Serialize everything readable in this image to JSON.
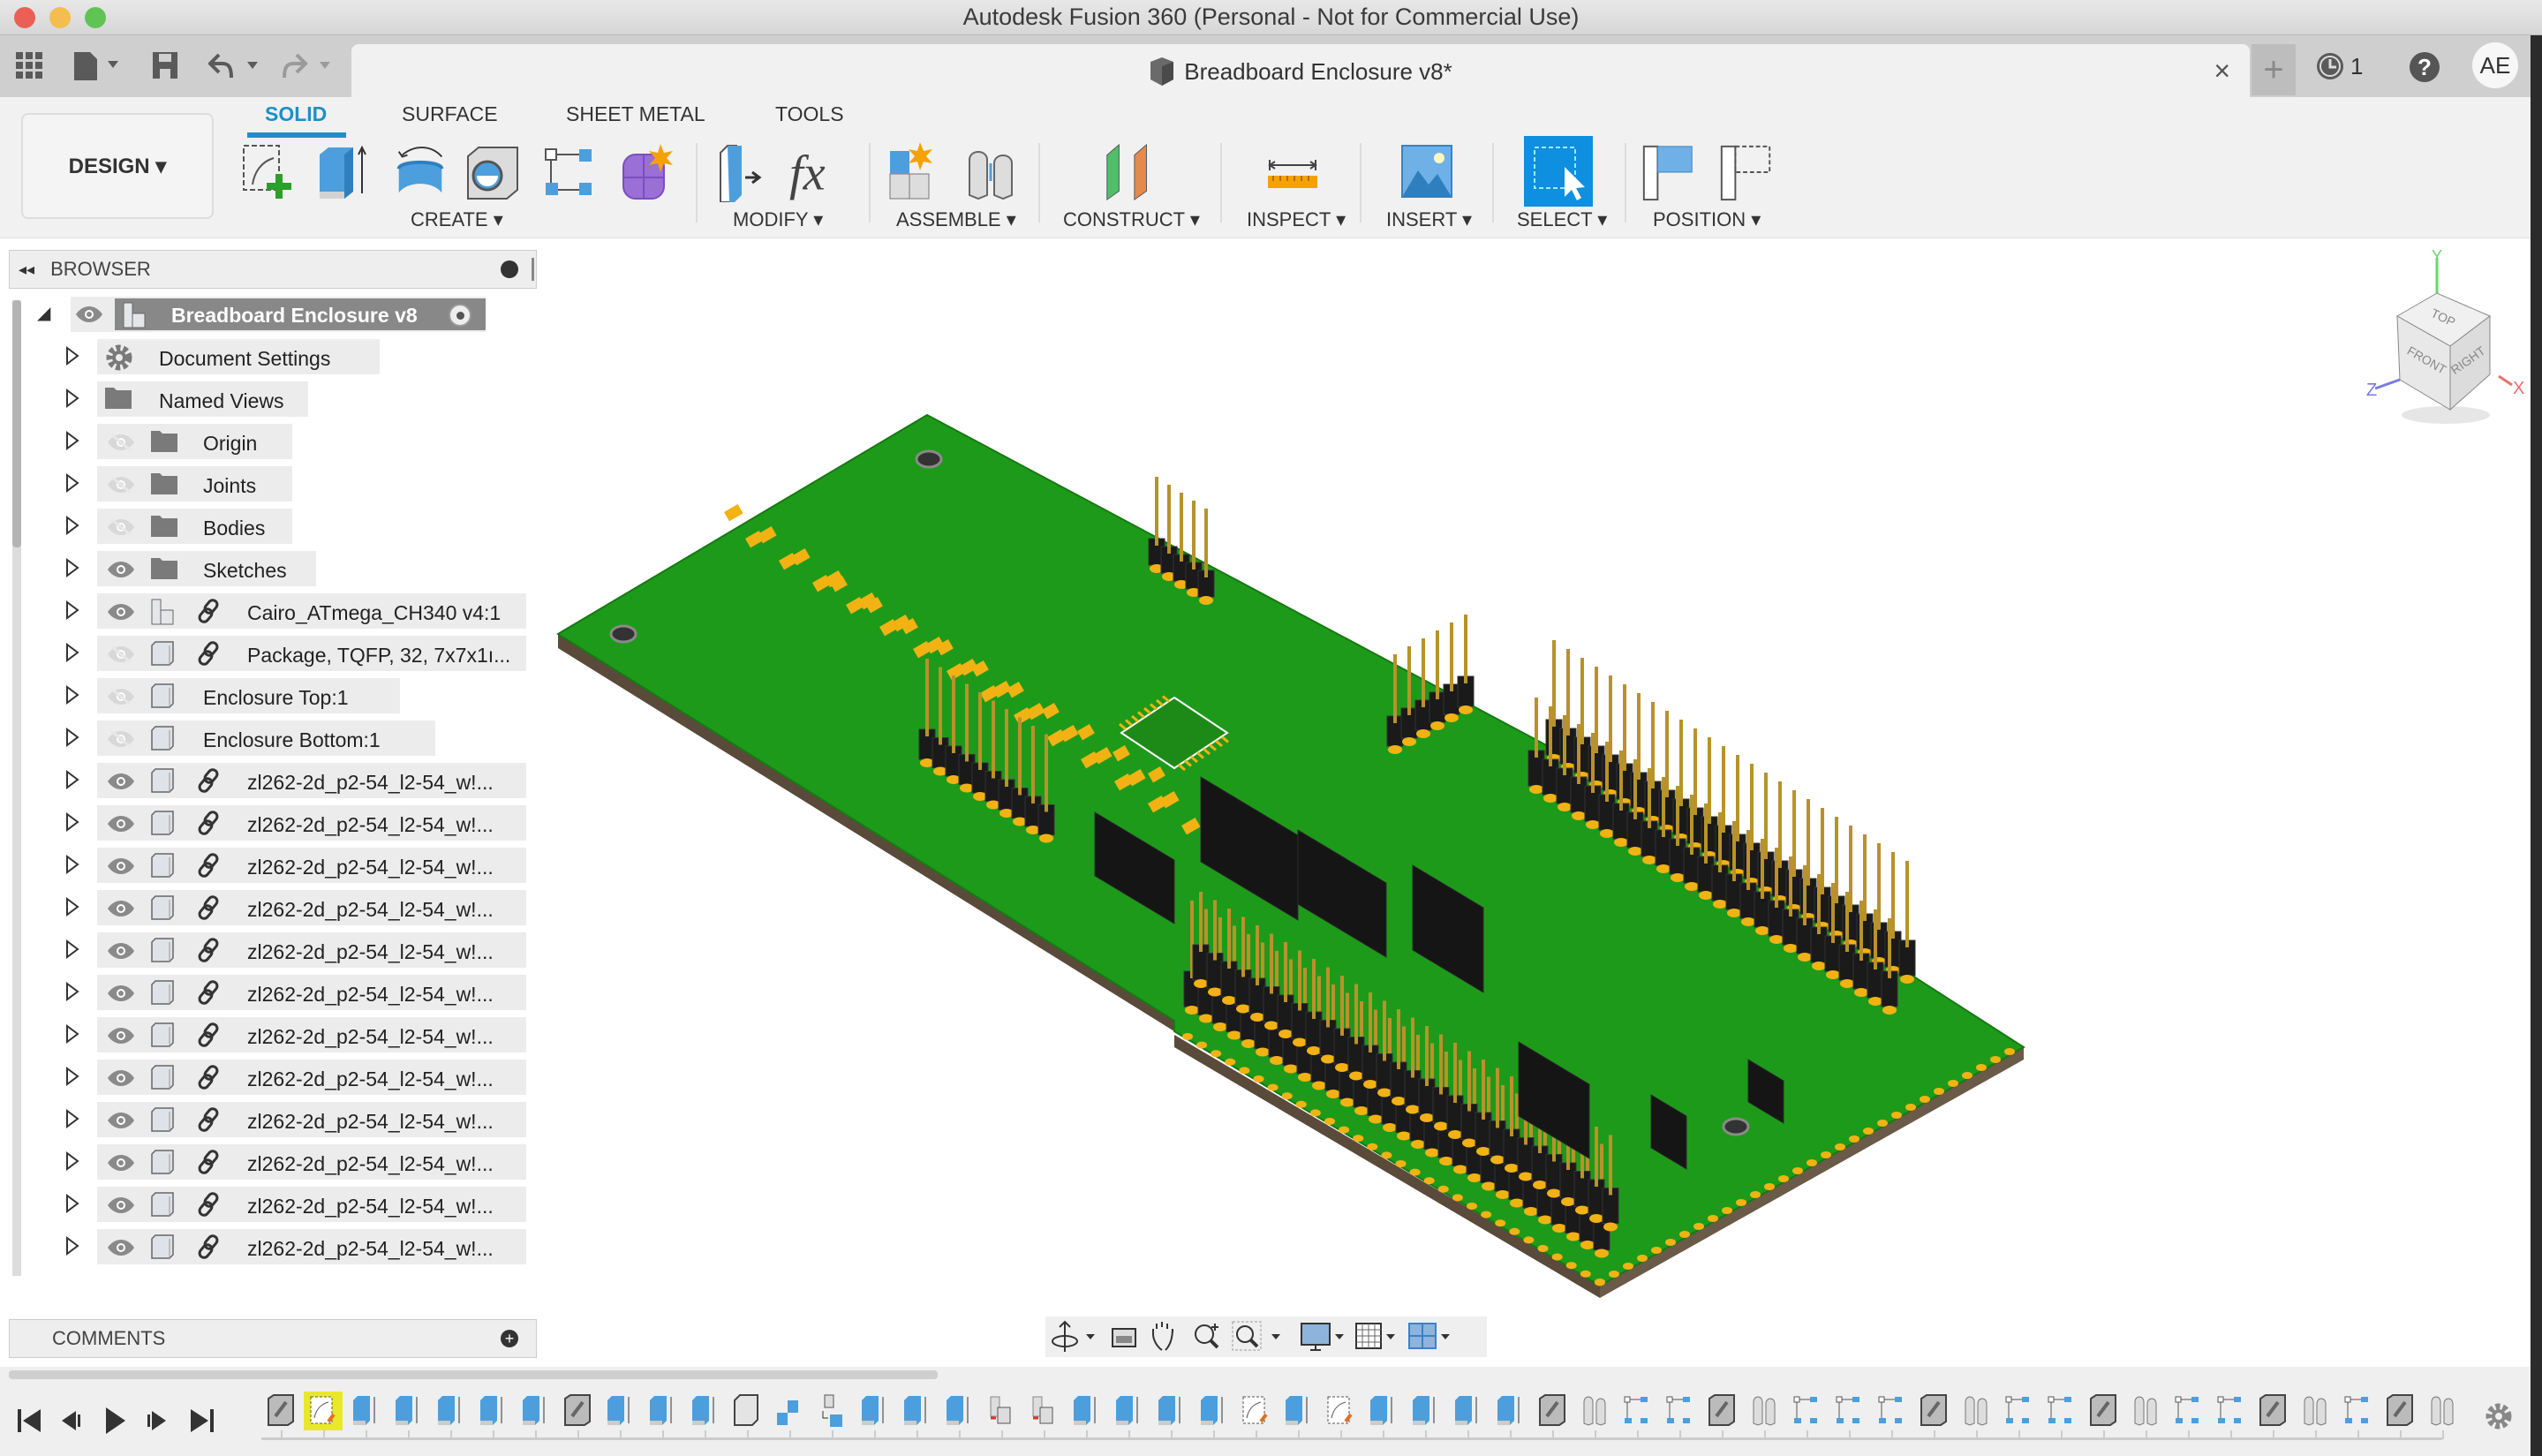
{
  "window": {
    "title": "Autodesk Fusion 360 (Personal - Not for Commercial Use)"
  },
  "quick_access": {
    "icons": [
      "grid-menu-icon",
      "file-icon",
      "save-icon",
      "undo-icon",
      "redo-icon"
    ]
  },
  "document_tab": {
    "title": "Breadboard Enclosure v8*",
    "close_label": "×",
    "new_tab_label": "+"
  },
  "header_right": {
    "jobs_count": "1",
    "help_label": "?",
    "user_initials": "AE"
  },
  "ribbon": {
    "workspace_label": "DESIGN ▾",
    "tabs": [
      {
        "label": "SOLID",
        "active": true
      },
      {
        "label": "SURFACE",
        "active": false
      },
      {
        "label": "SHEET METAL",
        "active": false
      },
      {
        "label": "TOOLS",
        "active": false
      }
    ],
    "groups": [
      {
        "label": "CREATE ▾",
        "tools": [
          "create-sketch",
          "extrude",
          "revolve",
          "hole",
          "rectangular-pattern",
          "create-form"
        ]
      },
      {
        "label": "MODIFY ▾",
        "tools": [
          "press-pull",
          "change-parameters"
        ]
      },
      {
        "label": "ASSEMBLE ▾",
        "tools": [
          "new-component",
          "joint"
        ]
      },
      {
        "label": "CONSTRUCT ▾",
        "tools": [
          "offset-plane"
        ]
      },
      {
        "label": "INSPECT ▾",
        "tools": [
          "measure"
        ]
      },
      {
        "label": "INSERT ▾",
        "tools": [
          "insert-canvas"
        ]
      },
      {
        "label": "SELECT ▾",
        "tools": [
          "select"
        ]
      },
      {
        "label": "POSITION ▾",
        "tools": [
          "capture-position",
          "revert-position"
        ]
      }
    ]
  },
  "browser": {
    "title": "BROWSER",
    "root": {
      "label": "Breadboard Enclosure v8",
      "visible": true
    },
    "items": [
      {
        "label": "Document Settings",
        "icon": "gear",
        "eye": null,
        "link": false
      },
      {
        "label": "Named Views",
        "icon": "folder",
        "eye": null,
        "link": false
      },
      {
        "label": "Origin",
        "icon": "folder",
        "eye": "hidden",
        "link": false
      },
      {
        "label": "Joints",
        "icon": "folder",
        "eye": "hidden",
        "link": false
      },
      {
        "label": "Bodies",
        "icon": "folder",
        "eye": "hidden",
        "link": false
      },
      {
        "label": "Sketches",
        "icon": "folder",
        "eye": "visible",
        "link": false
      },
      {
        "label": "Cairo_ATmega_CH340 v4:1",
        "icon": "assembly",
        "eye": "visible",
        "link": true
      },
      {
        "label": "Package, TQFP, 32, 7x7x1ı...",
        "icon": "component",
        "eye": "hidden",
        "link": true
      },
      {
        "label": "Enclosure Top:1",
        "icon": "component",
        "eye": "hidden",
        "link": false
      },
      {
        "label": "Enclosure Bottom:1",
        "icon": "component",
        "eye": "hidden",
        "link": false
      },
      {
        "label": "zl262-2d_p2-54_l2-54_w!...",
        "icon": "component",
        "eye": "visible",
        "link": true
      },
      {
        "label": "zl262-2d_p2-54_l2-54_w!...",
        "icon": "component",
        "eye": "visible",
        "link": true
      },
      {
        "label": "zl262-2d_p2-54_l2-54_w!...",
        "icon": "component",
        "eye": "visible",
        "link": true
      },
      {
        "label": "zl262-2d_p2-54_l2-54_w!...",
        "icon": "component",
        "eye": "visible",
        "link": true
      },
      {
        "label": "zl262-2d_p2-54_l2-54_w!...",
        "icon": "component",
        "eye": "visible",
        "link": true
      },
      {
        "label": "zl262-2d_p2-54_l2-54_w!...",
        "icon": "component",
        "eye": "visible",
        "link": true
      },
      {
        "label": "zl262-2d_p2-54_l2-54_w!...",
        "icon": "component",
        "eye": "visible",
        "link": true
      },
      {
        "label": "zl262-2d_p2-54_l2-54_w!...",
        "icon": "component",
        "eye": "visible",
        "link": true
      },
      {
        "label": "zl262-2d_p2-54_l2-54_w!...",
        "icon": "component",
        "eye": "visible",
        "link": true
      },
      {
        "label": "zl262-2d_p2-54_l2-54_w!...",
        "icon": "component",
        "eye": "visible",
        "link": true
      },
      {
        "label": "zl262-2d_p2-54_l2-54_w!...",
        "icon": "component",
        "eye": "visible",
        "link": true
      },
      {
        "label": "zl262-2d_p2-54_l2-54_w!...",
        "icon": "component",
        "eye": "visible",
        "link": true
      }
    ]
  },
  "comments": {
    "title": "COMMENTS"
  },
  "viewcube": {
    "top": "TOP",
    "front": "FRONT",
    "right": "RIGHT",
    "axis_x": "X",
    "axis_y": "Y",
    "axis_z": "Z"
  },
  "navbar": {
    "tools": [
      "orbit",
      "look-at",
      "pan",
      "zoom",
      "fit",
      "display-settings",
      "grid-snaps",
      "viewports"
    ]
  },
  "timeline": {
    "controls": [
      "go-to-start",
      "step-back",
      "play",
      "step-forward",
      "go-to-end"
    ],
    "features": [
      "joint",
      "sketch-active",
      "extrude",
      "extrude",
      "extrude",
      "extrude",
      "extrude",
      "joint",
      "extrude",
      "extrude",
      "extrude",
      "box",
      "move",
      "align",
      "extrude",
      "extrude",
      "extrude",
      "component-copy",
      "component-copy",
      "extrude",
      "extrude",
      "extrude",
      "extrude",
      "sketch",
      "extrude",
      "sketch",
      "extrude",
      "extrude",
      "extrude",
      "extrude",
      "joint",
      "rigid",
      "pattern",
      "pattern",
      "joint",
      "rigid",
      "pattern",
      "pattern",
      "pattern",
      "joint",
      "rigid",
      "pattern",
      "pattern",
      "joint",
      "rigid",
      "pattern",
      "pattern",
      "joint",
      "rigid",
      "pattern",
      "joint",
      "rigid"
    ]
  },
  "colors": {
    "accent": "#1e8fc6",
    "pcb_green": "#1e9a1a",
    "pad_gold": "#f2b213",
    "pin_gold": "#b8922a",
    "header_black": "#1a1a1a"
  }
}
